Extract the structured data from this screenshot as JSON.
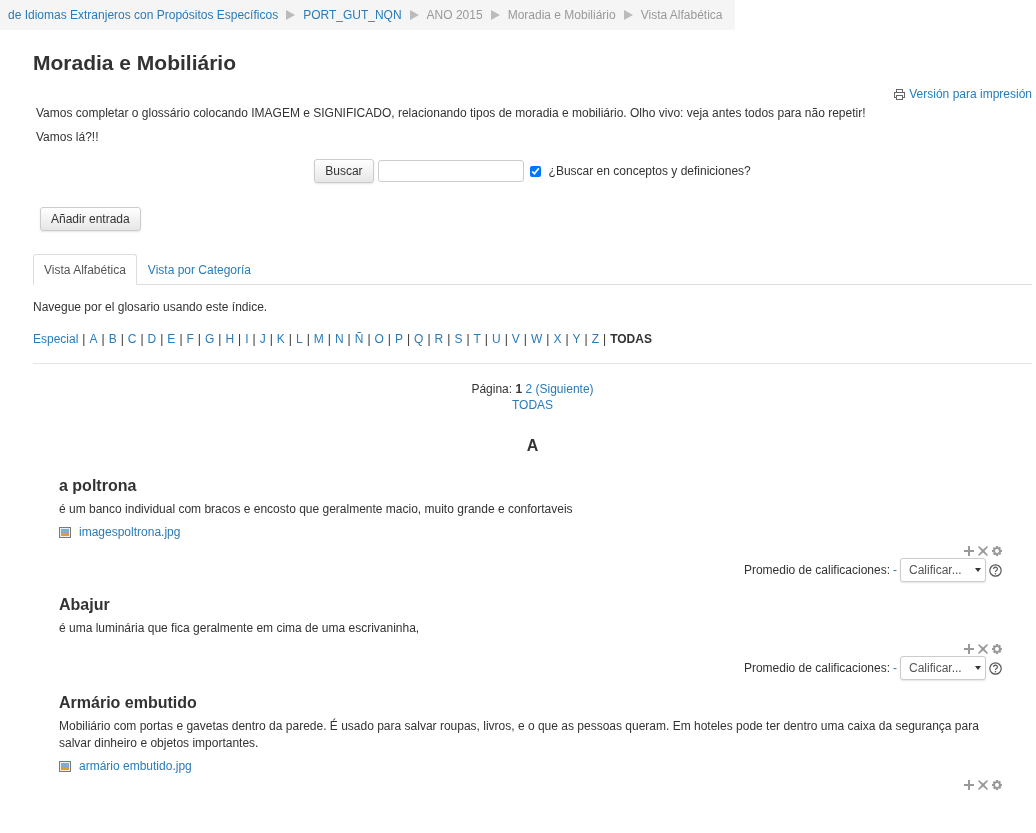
{
  "breadcrumb": [
    {
      "label": "de Idiomas Extranjeros con Propósitos Específicos",
      "link": true
    },
    {
      "label": "PORT_GUT_NQN",
      "link": true
    },
    {
      "label": "ANO 2015",
      "link": false
    },
    {
      "label": "Moradia e Mobiliário",
      "link": false
    },
    {
      "label": "Vista Alfabética",
      "link": false
    }
  ],
  "title": "Moradia e Mobiliário",
  "print_link": "Versión para impresión",
  "intro": [
    "Vamos completar o glossário colocando IMAGEM e SIGNIFICADO, relacionando tipos de moradia e mobiliário. Olho vivo: veja antes todos para não repetir!",
    "Vamos lá?!!"
  ],
  "search": {
    "button": "Buscar",
    "checked": true,
    "option_label": "¿Buscar en conceptos y definiciones?"
  },
  "add_button": "Añadir entrada",
  "tabs": [
    {
      "label": "Vista Alfabética",
      "selected": true
    },
    {
      "label": "Vista por Categoría",
      "selected": false
    }
  ],
  "index_hint": "Navegue por el glosario usando este índice.",
  "letters": [
    {
      "label": "Especial",
      "selected": false
    },
    {
      "separator": "|",
      "label": "A",
      "selected": false
    },
    {
      "separator": "|",
      "label": "B",
      "selected": false
    },
    {
      "separator": "|",
      "label": "C",
      "selected": false
    },
    {
      "separator": "|",
      "label": "D",
      "selected": false
    },
    {
      "separator": "|",
      "label": "E",
      "selected": false
    },
    {
      "separator": "|",
      "label": "F",
      "selected": false
    },
    {
      "separator": "|",
      "label": "G",
      "selected": false
    },
    {
      "separator": "|",
      "label": "H",
      "selected": false
    },
    {
      "separator": "|",
      "label": "I",
      "selected": false
    },
    {
      "separator": "|",
      "label": "J",
      "selected": false
    },
    {
      "separator": "|",
      "label": "K",
      "selected": false
    },
    {
      "separator": "|",
      "label": "L",
      "selected": false
    },
    {
      "separator": "|",
      "label": "M",
      "selected": false
    },
    {
      "separator": "|",
      "label": "N",
      "selected": false
    },
    {
      "separator": "|",
      "label": "Ñ",
      "selected": false
    },
    {
      "separator": "|",
      "label": "O",
      "selected": false
    },
    {
      "separator": "|",
      "label": "P",
      "selected": false
    },
    {
      "separator": "|",
      "label": "Q",
      "selected": false
    },
    {
      "separator": "|",
      "label": "R",
      "selected": false
    },
    {
      "separator": "|",
      "label": "S",
      "selected": false
    },
    {
      "separator": "|",
      "label": "T",
      "selected": false
    },
    {
      "separator": "|",
      "label": "U",
      "selected": false
    },
    {
      "separator": "|",
      "label": "V",
      "selected": false
    },
    {
      "separator": "|",
      "label": "W",
      "selected": false
    },
    {
      "separator": "|",
      "label": "X",
      "selected": false
    },
    {
      "separator": "|",
      "label": "Y",
      "selected": false
    },
    {
      "separator": "|",
      "label": "Z",
      "selected": false
    },
    {
      "separator": "|",
      "label": "TODAS",
      "selected": true
    }
  ],
  "paging": {
    "label": "Página:",
    "pages": [
      {
        "label": "1",
        "selected": true
      },
      {
        "label": "2",
        "selected": false
      }
    ],
    "next": "(Siguiente)",
    "all": "TODAS"
  },
  "section_letter": "A",
  "entries": [
    {
      "term": "a poltrona",
      "definition": "é um banco individual com bracos e encosto  que geralmente macio, muito grande e  confortaveis",
      "attachment": "imagespoltrona.jpg",
      "rating": {
        "label": "Promedio de calificaciones:",
        "value": "-",
        "select": "Calificar..."
      }
    },
    {
      "term": "Abajur",
      "definition": "é uma luminária que fica geralmente em cima de uma escrivaninha,",
      "rating": {
        "label": "Promedio de calificaciones:",
        "value": "-",
        "select": "Calificar..."
      }
    },
    {
      "term": "Armário embutido",
      "definition": "Mobiliário com portas e gavetas dentro da parede. É usado para salvar roupas, livros, e o que as pessoas queram. Em hoteles pode ter dentro uma caixa da segurança para salvar dinheiro e objetos importantes.",
      "attachment": "armário embutido.jpg"
    }
  ]
}
